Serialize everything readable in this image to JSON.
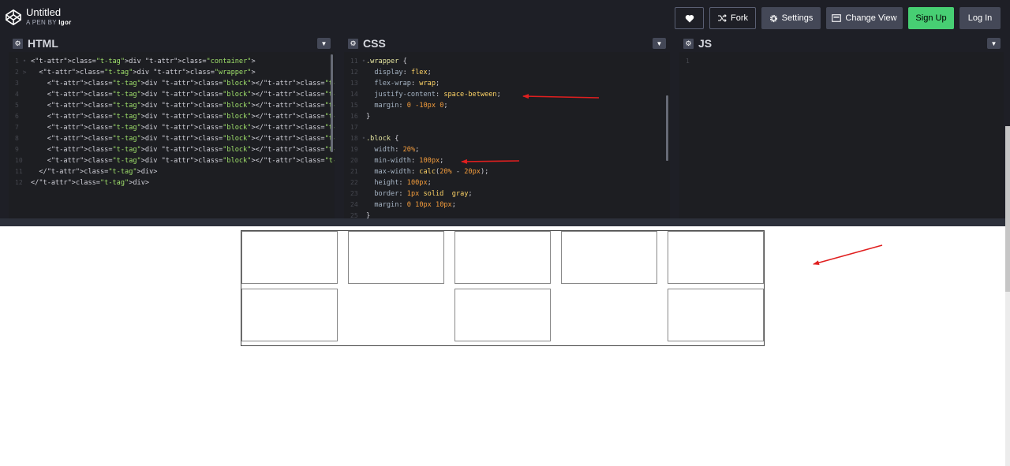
{
  "header": {
    "title": "Untitled",
    "pen_by_prefix": "A PEN BY",
    "author": "Igor",
    "buttons": {
      "heart_icon": "heart-icon",
      "fork": "Fork",
      "settings": "Settings",
      "change_view": "Change View",
      "signup": "Sign Up",
      "login": "Log In"
    },
    "colors": {
      "bar": "#1e1f26",
      "button": "#444857",
      "signup": "#47cf73"
    }
  },
  "editors": {
    "html": {
      "name": "HTML",
      "lines": [
        {
          "n": "1",
          "fold": "•",
          "code": "<div class=\"container\">"
        },
        {
          "n": "2",
          "fold": ">",
          "code": "  <div class=\"wrapper\">"
        },
        {
          "n": "3",
          "fold": "",
          "code": "    <div class=\"block\"></div>"
        },
        {
          "n": "4",
          "fold": "",
          "code": "    <div class=\"block\"></div>"
        },
        {
          "n": "5",
          "fold": "",
          "code": "    <div class=\"block\"></div>"
        },
        {
          "n": "6",
          "fold": "",
          "code": "    <div class=\"block\"></div>"
        },
        {
          "n": "7",
          "fold": "",
          "code": "    <div class=\"block\"></div>"
        },
        {
          "n": "8",
          "fold": "",
          "code": "    <div class=\"block\"></div>"
        },
        {
          "n": "9",
          "fold": "",
          "code": "    <div class=\"block\"></div>"
        },
        {
          "n": "10",
          "fold": "",
          "code": "    <div class=\"block\"></div>"
        },
        {
          "n": "11",
          "fold": "",
          "code": "  </div>"
        },
        {
          "n": "12",
          "fold": "",
          "code": "</div>"
        }
      ]
    },
    "css": {
      "name": "CSS",
      "lines": [
        {
          "n": "11",
          "fold": "•",
          "code": ".wrapper {"
        },
        {
          "n": "12",
          "fold": "",
          "code": "  display: flex;"
        },
        {
          "n": "13",
          "fold": "",
          "code": "  flex-wrap: wrap;"
        },
        {
          "n": "14",
          "fold": "",
          "code": "  justify-content: space-between;"
        },
        {
          "n": "15",
          "fold": "",
          "code": "  margin: 0 -10px 0;"
        },
        {
          "n": "16",
          "fold": "",
          "code": "}"
        },
        {
          "n": "17",
          "fold": "",
          "code": ""
        },
        {
          "n": "18",
          "fold": "•",
          "code": ".block {"
        },
        {
          "n": "19",
          "fold": "",
          "code": "  width: 20%;"
        },
        {
          "n": "20",
          "fold": "",
          "code": "  min-width: 100px;"
        },
        {
          "n": "21",
          "fold": "",
          "code": "  max-width: calc(20% - 20px);"
        },
        {
          "n": "22",
          "fold": "",
          "code": "  height: 100px;"
        },
        {
          "n": "23",
          "fold": "",
          "code": "  border: 1px solid  gray;"
        },
        {
          "n": "24",
          "fold": "",
          "code": "  margin: 0 10px 10px;"
        },
        {
          "n": "25",
          "fold": "",
          "code": "}"
        }
      ]
    },
    "js": {
      "name": "JS",
      "lines": [
        {
          "n": "1",
          "fold": "",
          "code": ""
        }
      ]
    }
  },
  "preview": {
    "rows": [
      [
        true,
        true,
        true,
        true,
        true
      ],
      [
        true,
        false,
        true,
        false,
        true
      ]
    ]
  },
  "annotations": {
    "arrow_color": "#e01f1f"
  }
}
